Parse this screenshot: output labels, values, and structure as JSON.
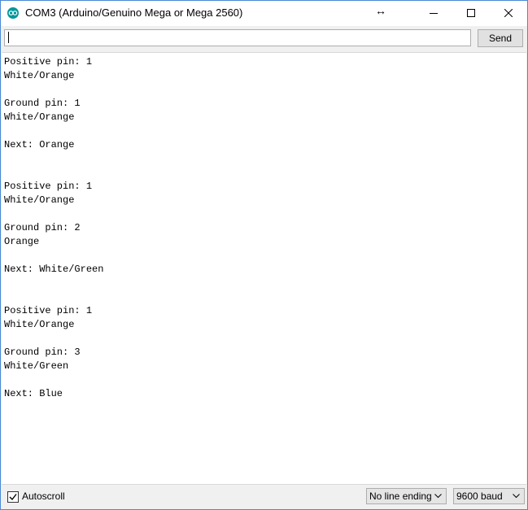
{
  "window": {
    "title": "COM3 (Arduino/Genuino Mega or Mega 2560)",
    "accent_color": "#00979c"
  },
  "input": {
    "value": "",
    "send_label": "Send"
  },
  "output": {
    "lines": [
      "Positive pin: 1",
      "White/Orange",
      "",
      "Ground pin: 1",
      "White/Orange",
      "",
      "Next: Orange",
      "",
      "",
      "Positive pin: 1",
      "White/Orange",
      "",
      "Ground pin: 2",
      "Orange",
      "",
      "Next: White/Green",
      "",
      "",
      "Positive pin: 1",
      "White/Orange",
      "",
      "Ground pin: 3",
      "White/Green",
      "",
      "Next: Blue"
    ]
  },
  "bottom": {
    "autoscroll_label": "Autoscroll",
    "autoscroll_checked": true,
    "line_ending": "No line ending",
    "baud": "9600 baud"
  }
}
